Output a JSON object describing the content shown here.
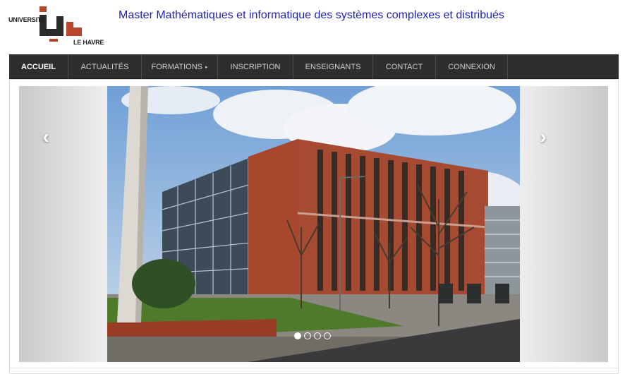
{
  "header": {
    "logo_top": "UNIVERSITÉ",
    "logo_bottom": "LE HAVRE",
    "title": "Master Mathématiques et informatique des systèmes complexes et distribués"
  },
  "nav": {
    "items": [
      {
        "label": "ACCUEIL",
        "active": true
      },
      {
        "label": "ACTUALITÉS",
        "active": false
      },
      {
        "label": "FORMATIONS",
        "active": false,
        "has_submenu": true
      },
      {
        "label": "INSCRIPTION",
        "active": false
      },
      {
        "label": "ENSEIGNANTS",
        "active": false
      },
      {
        "label": "CONTACT",
        "active": false
      },
      {
        "label": "CONNEXION",
        "active": false
      }
    ],
    "caret": "▸"
  },
  "carousel": {
    "prev": "‹",
    "next": "›",
    "slide_count": 4,
    "active_index": 0
  },
  "colors": {
    "title": "#2222bb",
    "nav_bg": "#2e2e2e",
    "brick": "#a8472e"
  }
}
